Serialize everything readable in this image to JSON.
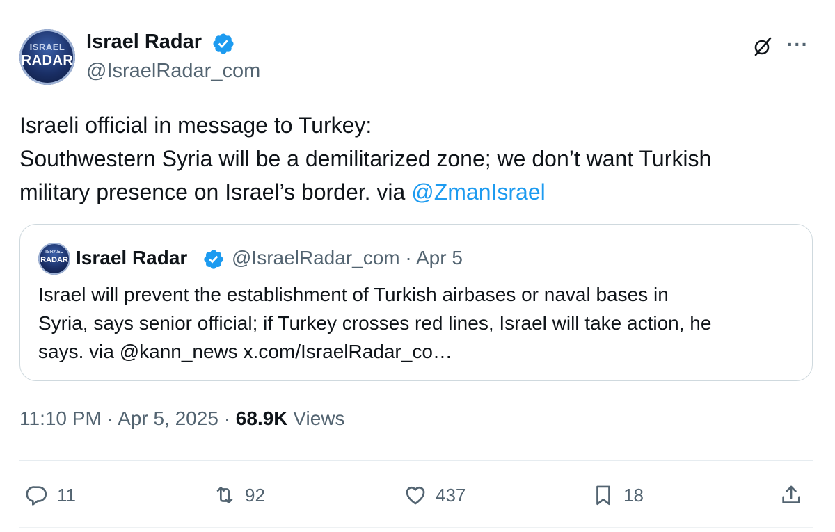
{
  "author": {
    "name": "Israel Radar",
    "handle": "@IsraelRadar_com",
    "avatar_text_top": "ISRAEL",
    "avatar_text_bottom": "RADAR"
  },
  "header_icons": {
    "grok": "grok-icon",
    "more": "more-icon",
    "more_glyph": "···"
  },
  "tweet": {
    "line1": "Israeli official in message to Turkey:",
    "line2": "Southwestern Syria will be a demilitarized zone; we don’t want Turkish",
    "line3_text": "military presence on Israel’s border. via ",
    "line3_mention": "@ZmanIsrael"
  },
  "quote": {
    "name": "Israel Radar",
    "handle": "@IsraelRadar_com",
    "separator": "·",
    "date": "Apr 5",
    "line1": "Israel will prevent the establishment of Turkish airbases or naval bases in",
    "line2": "Syria, says senior official; if Turkey crosses red lines, Israel will take action, he",
    "line3": "says. via @kann_news x.com/IsraelRadar_co…"
  },
  "meta": {
    "time": "11:10 PM",
    "date": "Apr 5, 2025",
    "separator": "·",
    "views_count": "68.9K",
    "views_label": "Views"
  },
  "actions": {
    "replies": "11",
    "reposts": "92",
    "likes": "437",
    "bookmarks": "18"
  },
  "colors": {
    "text": "#0f1419",
    "secondary": "#536471",
    "link": "#1d9bf0",
    "verified": "#1d9bf0",
    "border": "#cfd9de"
  }
}
